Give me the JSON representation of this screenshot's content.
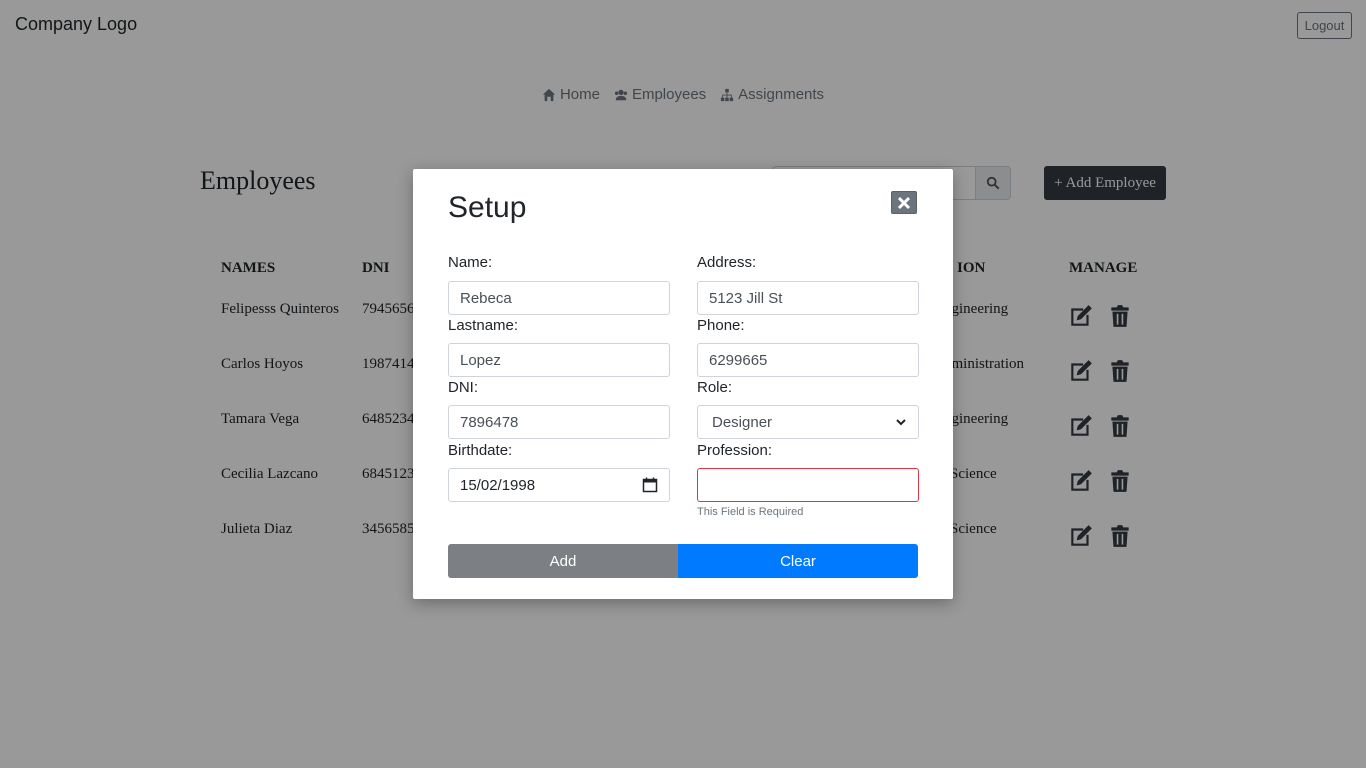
{
  "header": {
    "logo": "Company Logo",
    "logout_label": "Logout"
  },
  "nav": [
    {
      "label": "Home",
      "icon": "home-icon"
    },
    {
      "label": "Employees",
      "icon": "users-icon"
    },
    {
      "label": "Assignments",
      "icon": "sitemap-icon"
    }
  ],
  "page": {
    "title": "Employees",
    "add_button": "+ Add Employee"
  },
  "table": {
    "headers": {
      "names": "NAMES",
      "dni": "DNI",
      "profession": "ION",
      "manage": "MANAGE"
    },
    "rows": [
      {
        "name": "Felipesss Quinteros",
        "dni": "7945656",
        "profession": "ngineering"
      },
      {
        "name": "Carlos Hoyos",
        "dni": "1987414",
        "profession": "dministration"
      },
      {
        "name": "Tamara Vega",
        "dni": "6485234",
        "profession": "ngineering"
      },
      {
        "name": "Cecilia Lazcano",
        "dni": "6845123",
        "profession": "Science"
      },
      {
        "name": "Julieta Diaz",
        "dni": "3456585",
        "profession": "Science"
      }
    ]
  },
  "modal": {
    "title": "Setup",
    "fields": {
      "name": {
        "label": "Name:",
        "value": "Rebeca"
      },
      "address": {
        "label": "Address:",
        "value": "5123 Jill St"
      },
      "lastname": {
        "label": "Lastname:",
        "value": "Lopez"
      },
      "phone": {
        "label": "Phone:",
        "value": "6299665"
      },
      "dni": {
        "label": "DNI:",
        "value": "7896478"
      },
      "role": {
        "label": "Role:",
        "value": "Designer"
      },
      "birthdate": {
        "label": "Birthdate:",
        "value": "15/02/1998"
      },
      "profession": {
        "label": "Profession:",
        "value": "",
        "error": "This Field is Required"
      }
    },
    "add_label": "Add",
    "clear_label": "Clear"
  },
  "colors": {
    "primary": "#007bff",
    "secondary": "#6c757d",
    "dark": "#343a40",
    "error": "#dc3545"
  }
}
